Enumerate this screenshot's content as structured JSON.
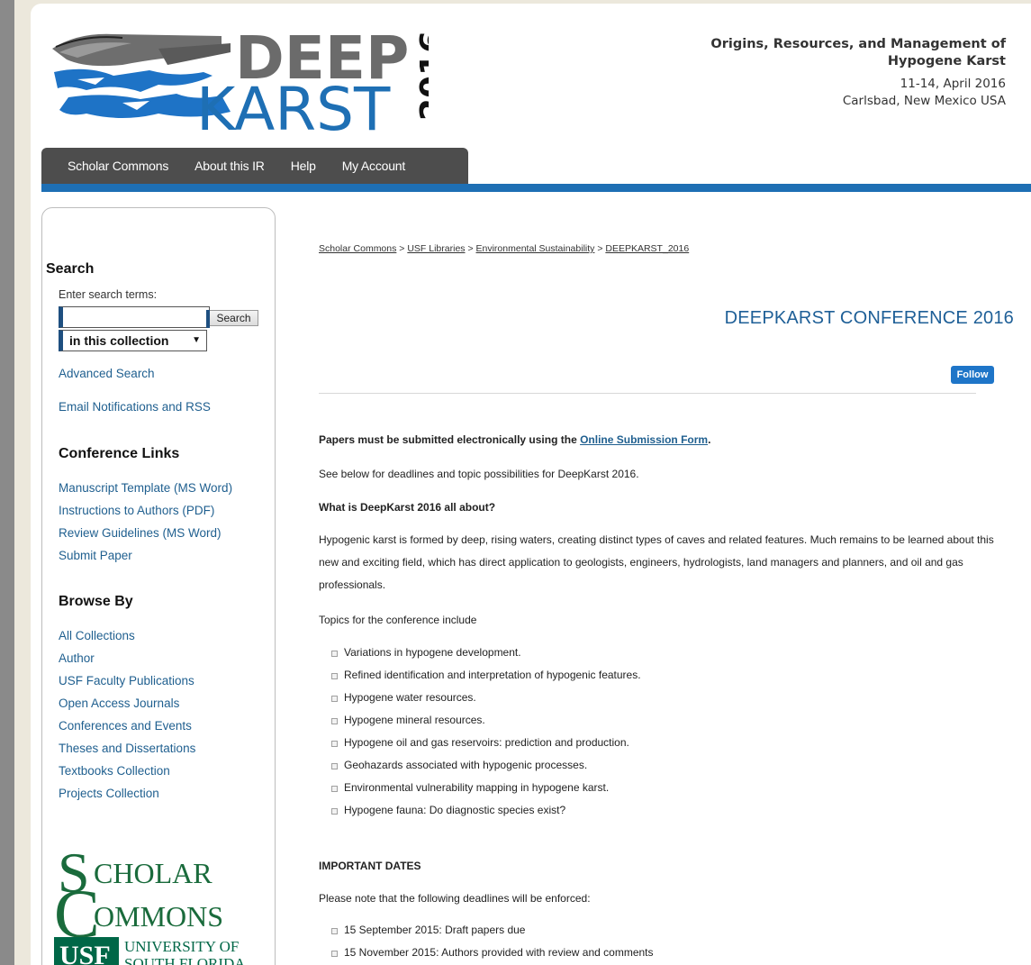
{
  "header": {
    "logo": {
      "text_deep": "DEEP",
      "text_karst": "KARST",
      "year": "2016"
    },
    "conference_info": {
      "line1": "Origins, Resources, and Management of",
      "line2": "Hypogene Karst",
      "dates": "11-14, April 2016",
      "location": "Carlsbad, New Mexico USA"
    }
  },
  "nav": {
    "items": [
      {
        "label": "Scholar Commons"
      },
      {
        "label": "About this IR"
      },
      {
        "label": "Help"
      },
      {
        "label": "My Account"
      }
    ]
  },
  "sidebar": {
    "search": {
      "heading": "Search",
      "prompt": "Enter search terms:",
      "input_value": "",
      "button_label": "Search",
      "scope_selected": "in this collection",
      "advanced": "Advanced Search",
      "notifications": "Email Notifications and RSS"
    },
    "conference_links": {
      "heading": "Conference Links",
      "items": [
        "Manuscript Template (MS Word)",
        "Instructions to Authors (PDF)",
        "Review Guidelines (MS Word)",
        "Submit Paper"
      ]
    },
    "browse": {
      "heading": "Browse By",
      "items": [
        "All Collections",
        "Author",
        "USF Faculty Publications",
        "Open Access Journals",
        "Conferences and Events",
        "Theses and Dissertations",
        "Textbooks Collection",
        "Projects Collection"
      ]
    },
    "logo": {
      "scholar": "CHOLAR",
      "commons": "OMMONS",
      "usf": "USF",
      "university_line1": "UNIVERSITY OF",
      "university_line2": "SOUTH FLORIDA"
    }
  },
  "main": {
    "breadcrumb": [
      "Scholar Commons",
      "USF Libraries",
      "Environmental Sustainability",
      "DEEPKARST_2016"
    ],
    "breadcrumb_sep": " > ",
    "title": "DEEPKARST CONFERENCE 2016",
    "follow_label": "Follow",
    "submission_prefix": "Papers must be submitted electronically using the ",
    "submission_link": "Online Submission Form",
    "submission_suffix": ".",
    "see_below": "See below for deadlines and topic possibilities for DeepKarst 2016.",
    "what_heading": "What is DeepKarst 2016 all about?",
    "description": "Hypogenic karst is formed by deep, rising waters, creating distinct types of caves and related features. Much remains to be learned about this new and exciting field, which has direct application to geologists, engineers, hydrologists, land managers and planners, and oil and gas professionals.",
    "topics_intro": "Topics for the conference include",
    "topics": [
      "Variations in hypogene development.",
      "Refined identification and interpretation of hypogenic features.",
      "Hypogene water resources.",
      "Hypogene mineral resources.",
      "Hypogene oil and gas reservoirs: prediction and production.",
      "Geohazards associated with hypogenic processes.",
      "Environmental vulnerability mapping in hypogene karst.",
      "Hypogene fauna: Do diagnostic species exist?"
    ],
    "dates_heading": "IMPORTANT DATES",
    "dates_intro": "Please note that the following deadlines will be enforced:",
    "dates": [
      "15 September 2015: Draft papers due",
      "15 November 2015: Authors provided with review and comments"
    ]
  },
  "colors": {
    "accent_blue": "#1e6fb4",
    "title_blue": "#1e5f97",
    "nav_gray": "#4d4d4d",
    "usf_green": "#006747"
  }
}
